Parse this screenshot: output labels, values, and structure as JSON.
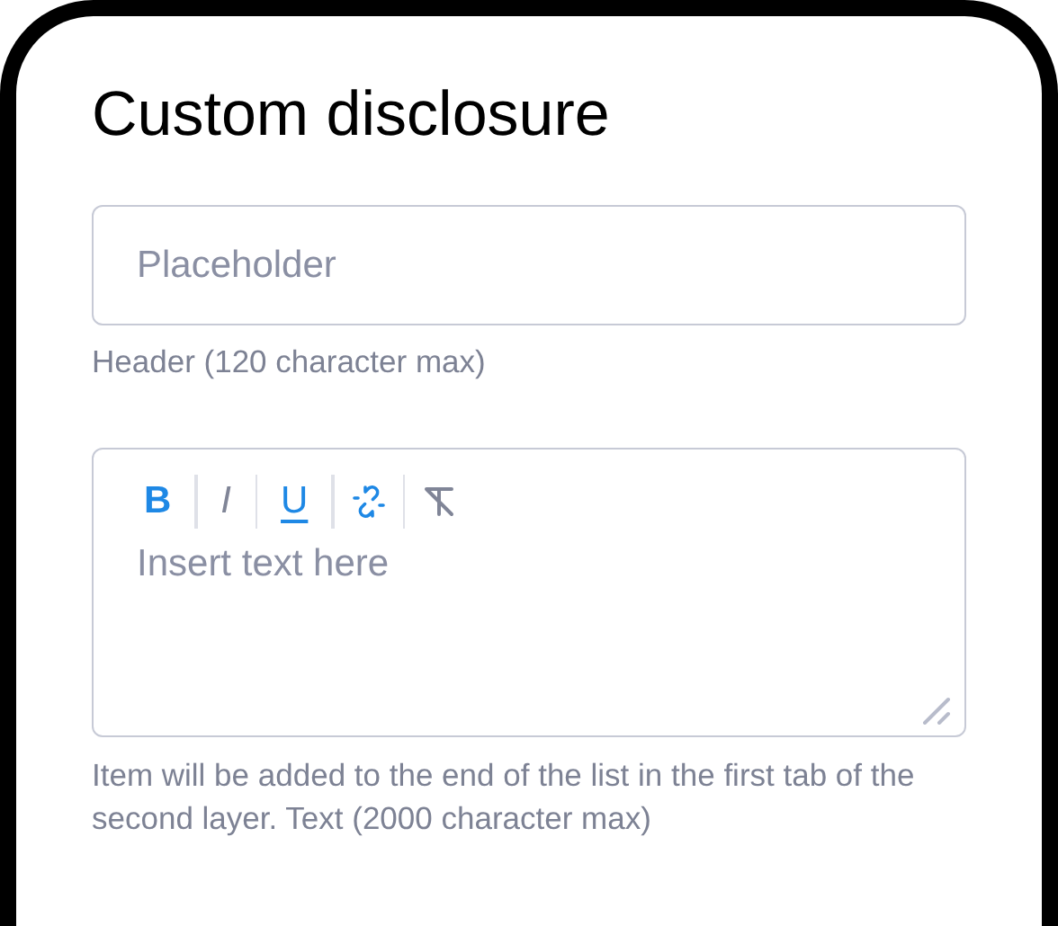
{
  "title": "Custom disclosure",
  "header_field": {
    "placeholder": "Placeholder",
    "hint": "Header (120 character max)"
  },
  "editor": {
    "toolbar": [
      {
        "kind": "bold",
        "label": "B",
        "active": true
      },
      {
        "kind": "italic",
        "label": "I",
        "active": false
      },
      {
        "kind": "underline",
        "label": "U",
        "active": true
      },
      {
        "kind": "link",
        "active": true
      },
      {
        "kind": "clear",
        "active": false
      }
    ],
    "placeholder": "Insert text here",
    "hint": "Item will be added to the end of the list in the first tab of the second layer. Text (2000 character max)"
  }
}
